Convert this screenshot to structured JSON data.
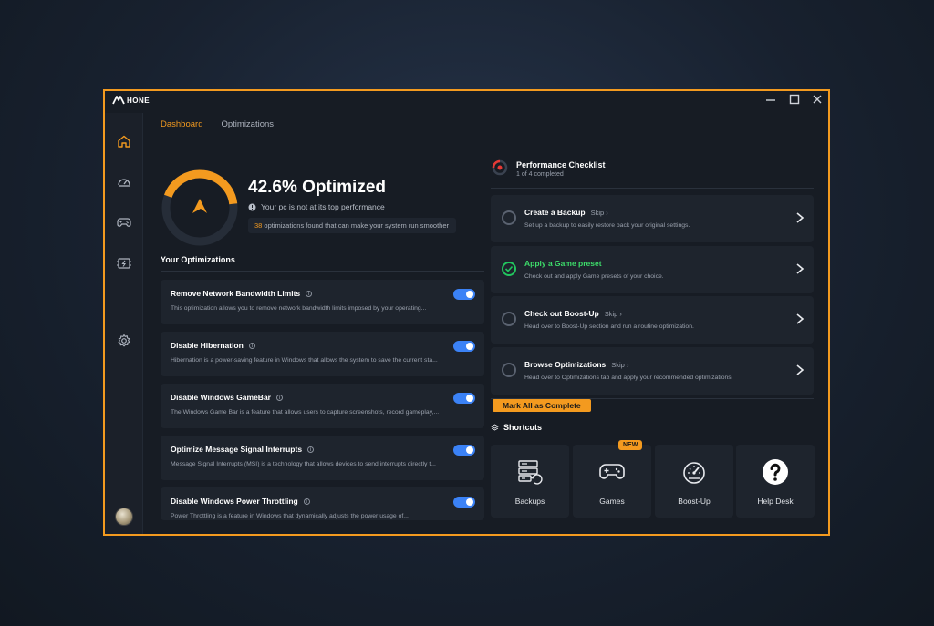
{
  "app": {
    "name": "HONE"
  },
  "window_controls": {
    "minimize": "—",
    "maximize": "☐",
    "close": "✕"
  },
  "tabs": [
    {
      "label": "Dashboard",
      "active": true
    },
    {
      "label": "Optimizations",
      "active": false
    }
  ],
  "sidebar": {
    "items": [
      {
        "icon": "home-icon",
        "active": true
      },
      {
        "icon": "speedometer-icon"
      },
      {
        "icon": "gamepad-icon"
      },
      {
        "icon": "cpu-chip-icon"
      },
      {
        "icon": "gear-icon"
      }
    ]
  },
  "overview": {
    "percent": 42.6,
    "title": "42.6% Optimized",
    "warning": "Your pc is not at its top performance",
    "found_count": "38",
    "found_text": " optimizations found that can make your system run smoother"
  },
  "your_optimizations": {
    "heading": "Your Optimizations",
    "items": [
      {
        "name": "Remove Network Bandwidth Limits",
        "desc": "This optimization allows you to remove network bandwidth limits imposed by your operating...",
        "enabled": true
      },
      {
        "name": "Disable Hibernation",
        "desc": "Hibernation is a power-saving feature in Windows that allows the system to save the current sta...",
        "enabled": true
      },
      {
        "name": "Disable Windows GameBar",
        "desc": "The Windows Game Bar is a feature that allows users to capture screenshots, record gameplay,...",
        "enabled": true
      },
      {
        "name": "Optimize Message Signal Interrupts",
        "desc": "Message Signal Interrupts (MSI) is a technology that allows devices to send interrupts directly t...",
        "enabled": true
      },
      {
        "name": "Disable Windows Power Throttling",
        "desc": "Power Throttling is a feature in Windows that dynamically adjusts the power usage of...",
        "enabled": true
      }
    ]
  },
  "checklist": {
    "title": "Performance Checklist",
    "subtitle": "1 of 4 completed",
    "items": [
      {
        "name": "Create a Backup",
        "skip": "Skip",
        "desc": "Set up a backup to easily restore back your original settings.",
        "done": false
      },
      {
        "name": "Apply a Game preset",
        "skip": "",
        "desc": "Check out and apply Game presets of your choice.",
        "done": true
      },
      {
        "name": "Check out Boost-Up",
        "skip": "Skip",
        "desc": "Head over to Boost-Up section and run a routine optimization.",
        "done": false
      },
      {
        "name": "Browse Optimizations",
        "skip": "Skip",
        "desc": "Head over to Optimizations tab and apply your recommended optimizations.",
        "done": false
      }
    ],
    "mark_all": "Mark All as Complete"
  },
  "shortcuts": {
    "heading": "Shortcuts",
    "items": [
      {
        "label": "Backups",
        "icon": "server-restore-icon"
      },
      {
        "label": "Games",
        "icon": "gamepad-icon",
        "badge": "NEW"
      },
      {
        "label": "Boost-Up",
        "icon": "speedometer-icon"
      },
      {
        "label": "Help Desk",
        "icon": "help-question-icon"
      }
    ]
  },
  "colors": {
    "accent": "#f39a1f",
    "toggle": "#3b82f6",
    "success": "#22c55e",
    "window_bg": "#171c24",
    "card_bg": "#1e242d"
  }
}
